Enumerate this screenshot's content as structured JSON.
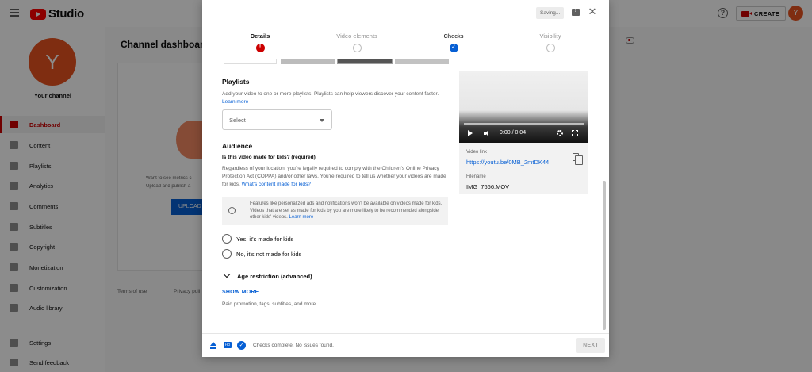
{
  "app": {
    "logo_text": "Studio"
  },
  "topbar": {
    "create_label": "CREATE",
    "avatar_initial": "Y"
  },
  "sidebar": {
    "avatar_initial": "Y",
    "channel_label": "Your channel",
    "items": [
      {
        "label": "Dashboard",
        "icon": "dashboard-icon",
        "active": true
      },
      {
        "label": "Content",
        "icon": "content-icon"
      },
      {
        "label": "Playlists",
        "icon": "playlists-icon"
      },
      {
        "label": "Analytics",
        "icon": "analytics-icon"
      },
      {
        "label": "Comments",
        "icon": "comments-icon"
      },
      {
        "label": "Subtitles",
        "icon": "subtitles-icon"
      },
      {
        "label": "Copyright",
        "icon": "copyright-icon"
      },
      {
        "label": "Monetization",
        "icon": "monetization-icon"
      },
      {
        "label": "Customization",
        "icon": "customization-icon"
      },
      {
        "label": "Audio library",
        "icon": "audio-library-icon"
      }
    ],
    "bottom_items": [
      {
        "label": "Settings",
        "icon": "settings-icon"
      },
      {
        "label": "Send feedback",
        "icon": "feedback-icon"
      }
    ]
  },
  "dashboard": {
    "title": "Channel dashboard",
    "card_text_1": "Want to see metrics c",
    "card_text_2": "Upload and publish a",
    "upload_label": "UPLOAD",
    "footer_links": [
      "Terms of use",
      "Privacy poli"
    ]
  },
  "modal": {
    "saving_label": "Saving...",
    "steps": [
      {
        "label": "Details",
        "state": "error"
      },
      {
        "label": "Video elements",
        "state": "pending"
      },
      {
        "label": "Checks",
        "state": "done"
      },
      {
        "label": "Visibility",
        "state": "pending"
      }
    ],
    "playlists": {
      "title": "Playlists",
      "description": "Add your video to one or more playlists. Playlists can help viewers discover your content faster.",
      "learn_more": "Learn more",
      "select_value": "Select"
    },
    "audience": {
      "title": "Audience",
      "question": "Is this video made for kids? (required)",
      "description": "Regardless of your location, you're legally required to comply with the Children's Online Privacy Protection Act (COPPA) and/or other laws. You're required to tell us whether your videos are made for kids.",
      "link": "What's content made for kids?",
      "info": "Features like personalized ads and notifications won't be available on videos made for kids. Videos that are set as made for kids by you are more likely to be recommended alongside other kids' videos.",
      "info_link": "Learn more",
      "option_yes": "Yes, it's made for kids",
      "option_no": "No, it's not made for kids"
    },
    "age_restriction": {
      "label": "Age restriction (advanced)"
    },
    "show_more": {
      "label": "SHOW MORE",
      "sub": "Paid promotion, tags, subtitles, and more"
    },
    "preview": {
      "time": "0:00 / 0:04",
      "video_link_label": "Video link",
      "video_link": "https://youtu.be/0MB_2mtDK44",
      "filename_label": "Filename",
      "filename": "IMG_7666.MOV"
    },
    "footer": {
      "status": "Checks complete. No issues found.",
      "next_label": "NEXT"
    }
  },
  "colors": {
    "accent": "#065fd4",
    "brand": "#ff0000",
    "error": "#cc0000",
    "avatar": "#e8531f"
  }
}
